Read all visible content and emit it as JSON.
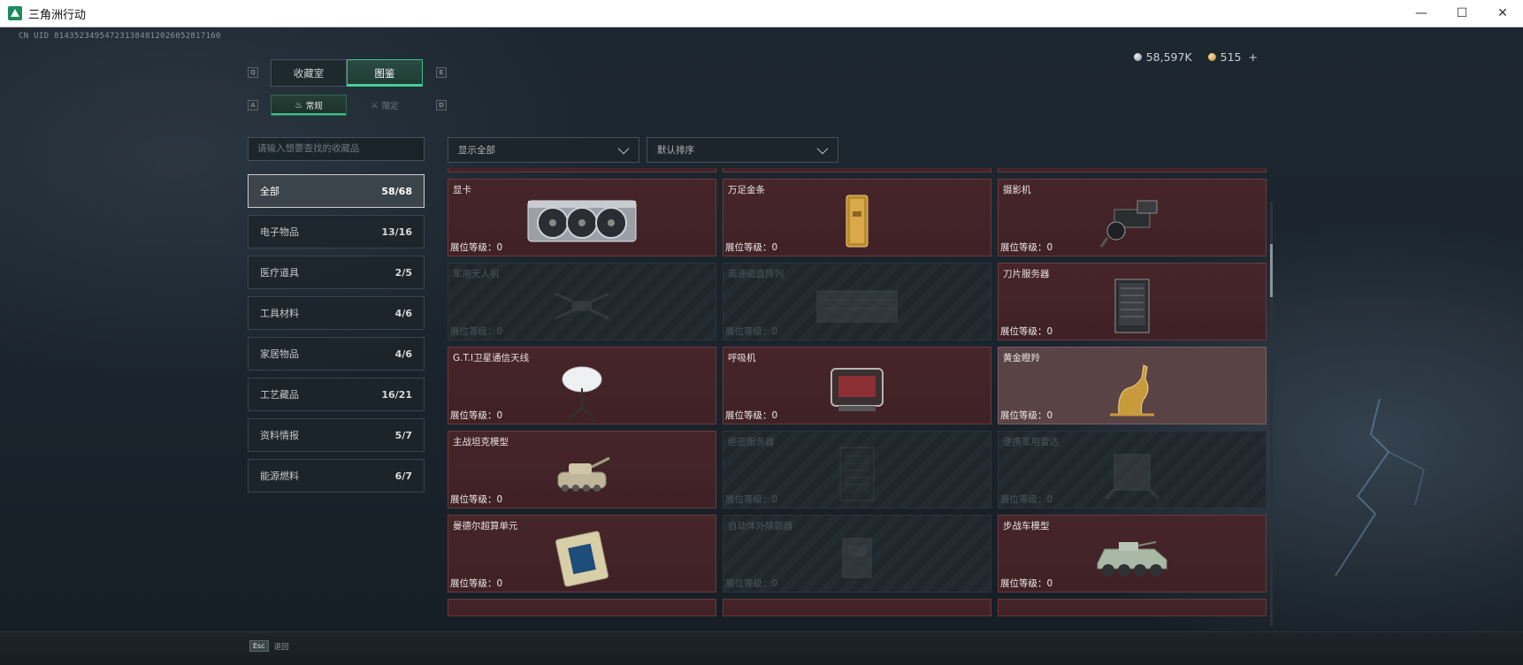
{
  "window": {
    "title": "三角洲行动",
    "controls": {
      "minimize": "—",
      "maximize": "☐",
      "close": "✕"
    }
  },
  "uid_text": "CN UID 814352349547231384812026052817160",
  "currency": {
    "silver": "58,597K",
    "gold": "515",
    "plus": "+"
  },
  "key_hints": {
    "q": "Q",
    "e": "E",
    "a": "A",
    "d": "D"
  },
  "main_tabs": [
    {
      "label": "收藏室",
      "active": false
    },
    {
      "label": "图鉴",
      "active": true
    }
  ],
  "sub_tabs": [
    {
      "label": "常规",
      "icon": "flame-icon",
      "active": true
    },
    {
      "label": "限定",
      "icon": "crossed-swords-icon",
      "active": false
    }
  ],
  "search": {
    "placeholder": "请输入想要查找的收藏品"
  },
  "categories": [
    {
      "label": "全部",
      "count": "58/68",
      "active": true
    },
    {
      "label": "电子物品",
      "count": "13/16",
      "active": false
    },
    {
      "label": "医疗道具",
      "count": "2/5",
      "active": false
    },
    {
      "label": "工具材料",
      "count": "4/6",
      "active": false
    },
    {
      "label": "家居物品",
      "count": "4/6",
      "active": false
    },
    {
      "label": "工艺藏品",
      "count": "16/21",
      "active": false
    },
    {
      "label": "资料情报",
      "count": "5/7",
      "active": false
    },
    {
      "label": "能源燃料",
      "count": "6/7",
      "active": false
    }
  ],
  "filters": {
    "show": "显示全部",
    "sort": "默认排序"
  },
  "items": [
    {
      "name": "显卡",
      "level": "展位等级：0",
      "state": "owned",
      "icon": "graphics-card-icon"
    },
    {
      "name": "万足金条",
      "level": "展位等级：0",
      "state": "owned",
      "icon": "gold-bar-icon"
    },
    {
      "name": "摄影机",
      "level": "展位等级：0",
      "state": "owned",
      "icon": "camera-icon"
    },
    {
      "name": "军用无人机",
      "level": "展位等级：0",
      "state": "locked",
      "icon": "drone-icon"
    },
    {
      "name": "高速磁盘阵列",
      "level": "展位等级：0",
      "state": "locked",
      "icon": "disk-array-icon"
    },
    {
      "name": "刀片服务器",
      "level": "展位等级：0",
      "state": "owned",
      "icon": "server-icon"
    },
    {
      "name": "G.T.I卫星通信天线",
      "level": "展位等级：0",
      "state": "owned",
      "icon": "satellite-dish-icon"
    },
    {
      "name": "呼吸机",
      "level": "展位等级：0",
      "state": "owned",
      "icon": "ventilator-icon"
    },
    {
      "name": "黄金瞪羚",
      "level": "展位等级：0",
      "state": "owned-light",
      "icon": "golden-gazelle-icon"
    },
    {
      "name": "主战坦克模型",
      "level": "展位等级：0",
      "state": "owned",
      "icon": "tank-icon"
    },
    {
      "name": "绝密服务器",
      "level": "展位等级：0",
      "state": "locked",
      "icon": "server-icon"
    },
    {
      "name": "便携军用雷达",
      "level": "展位等级：0",
      "state": "locked",
      "icon": "radar-icon"
    },
    {
      "name": "曼德尔超算单元",
      "level": "展位等级：0",
      "state": "owned",
      "icon": "chip-icon"
    },
    {
      "name": "自动体外除颤器",
      "level": "展位等级：0",
      "state": "locked",
      "icon": "defibrillator-icon"
    },
    {
      "name": "步战车模型",
      "level": "展位等级：0",
      "state": "owned",
      "icon": "ifv-icon"
    }
  ],
  "bottom": {
    "esc_key": "Esc",
    "esc_label": "退回"
  }
}
